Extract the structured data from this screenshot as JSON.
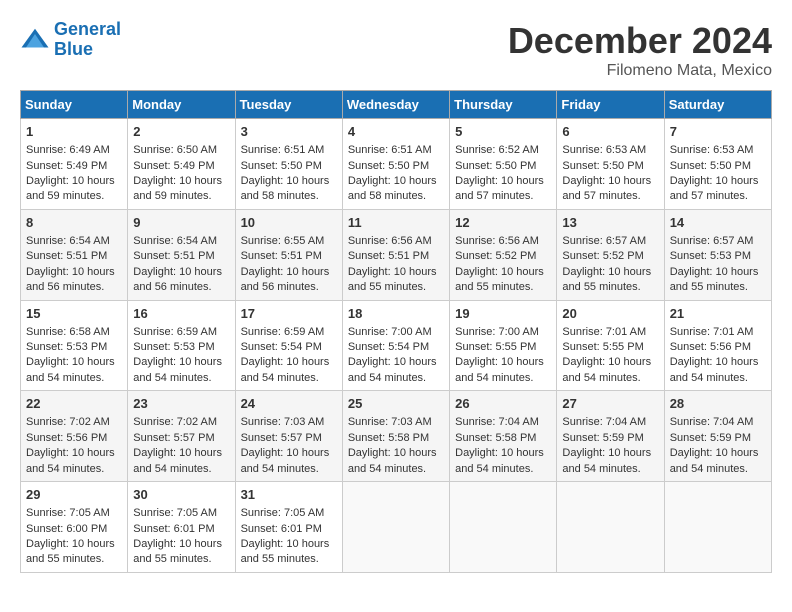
{
  "header": {
    "logo_line1": "General",
    "logo_line2": "Blue",
    "month": "December 2024",
    "location": "Filomeno Mata, Mexico"
  },
  "weekdays": [
    "Sunday",
    "Monday",
    "Tuesday",
    "Wednesday",
    "Thursday",
    "Friday",
    "Saturday"
  ],
  "weeks": [
    [
      {
        "day": "1",
        "sunrise": "6:49 AM",
        "sunset": "5:49 PM",
        "daylight": "10 hours and 59 minutes."
      },
      {
        "day": "2",
        "sunrise": "6:50 AM",
        "sunset": "5:49 PM",
        "daylight": "10 hours and 59 minutes."
      },
      {
        "day": "3",
        "sunrise": "6:51 AM",
        "sunset": "5:50 PM",
        "daylight": "10 hours and 58 minutes."
      },
      {
        "day": "4",
        "sunrise": "6:51 AM",
        "sunset": "5:50 PM",
        "daylight": "10 hours and 58 minutes."
      },
      {
        "day": "5",
        "sunrise": "6:52 AM",
        "sunset": "5:50 PM",
        "daylight": "10 hours and 57 minutes."
      },
      {
        "day": "6",
        "sunrise": "6:53 AM",
        "sunset": "5:50 PM",
        "daylight": "10 hours and 57 minutes."
      },
      {
        "day": "7",
        "sunrise": "6:53 AM",
        "sunset": "5:50 PM",
        "daylight": "10 hours and 57 minutes."
      }
    ],
    [
      {
        "day": "8",
        "sunrise": "6:54 AM",
        "sunset": "5:51 PM",
        "daylight": "10 hours and 56 minutes."
      },
      {
        "day": "9",
        "sunrise": "6:54 AM",
        "sunset": "5:51 PM",
        "daylight": "10 hours and 56 minutes."
      },
      {
        "day": "10",
        "sunrise": "6:55 AM",
        "sunset": "5:51 PM",
        "daylight": "10 hours and 56 minutes."
      },
      {
        "day": "11",
        "sunrise": "6:56 AM",
        "sunset": "5:51 PM",
        "daylight": "10 hours and 55 minutes."
      },
      {
        "day": "12",
        "sunrise": "6:56 AM",
        "sunset": "5:52 PM",
        "daylight": "10 hours and 55 minutes."
      },
      {
        "day": "13",
        "sunrise": "6:57 AM",
        "sunset": "5:52 PM",
        "daylight": "10 hours and 55 minutes."
      },
      {
        "day": "14",
        "sunrise": "6:57 AM",
        "sunset": "5:53 PM",
        "daylight": "10 hours and 55 minutes."
      }
    ],
    [
      {
        "day": "15",
        "sunrise": "6:58 AM",
        "sunset": "5:53 PM",
        "daylight": "10 hours and 54 minutes."
      },
      {
        "day": "16",
        "sunrise": "6:59 AM",
        "sunset": "5:53 PM",
        "daylight": "10 hours and 54 minutes."
      },
      {
        "day": "17",
        "sunrise": "6:59 AM",
        "sunset": "5:54 PM",
        "daylight": "10 hours and 54 minutes."
      },
      {
        "day": "18",
        "sunrise": "7:00 AM",
        "sunset": "5:54 PM",
        "daylight": "10 hours and 54 minutes."
      },
      {
        "day": "19",
        "sunrise": "7:00 AM",
        "sunset": "5:55 PM",
        "daylight": "10 hours and 54 minutes."
      },
      {
        "day": "20",
        "sunrise": "7:01 AM",
        "sunset": "5:55 PM",
        "daylight": "10 hours and 54 minutes."
      },
      {
        "day": "21",
        "sunrise": "7:01 AM",
        "sunset": "5:56 PM",
        "daylight": "10 hours and 54 minutes."
      }
    ],
    [
      {
        "day": "22",
        "sunrise": "7:02 AM",
        "sunset": "5:56 PM",
        "daylight": "10 hours and 54 minutes."
      },
      {
        "day": "23",
        "sunrise": "7:02 AM",
        "sunset": "5:57 PM",
        "daylight": "10 hours and 54 minutes."
      },
      {
        "day": "24",
        "sunrise": "7:03 AM",
        "sunset": "5:57 PM",
        "daylight": "10 hours and 54 minutes."
      },
      {
        "day": "25",
        "sunrise": "7:03 AM",
        "sunset": "5:58 PM",
        "daylight": "10 hours and 54 minutes."
      },
      {
        "day": "26",
        "sunrise": "7:04 AM",
        "sunset": "5:58 PM",
        "daylight": "10 hours and 54 minutes."
      },
      {
        "day": "27",
        "sunrise": "7:04 AM",
        "sunset": "5:59 PM",
        "daylight": "10 hours and 54 minutes."
      },
      {
        "day": "28",
        "sunrise": "7:04 AM",
        "sunset": "5:59 PM",
        "daylight": "10 hours and 54 minutes."
      }
    ],
    [
      {
        "day": "29",
        "sunrise": "7:05 AM",
        "sunset": "6:00 PM",
        "daylight": "10 hours and 55 minutes."
      },
      {
        "day": "30",
        "sunrise": "7:05 AM",
        "sunset": "6:01 PM",
        "daylight": "10 hours and 55 minutes."
      },
      {
        "day": "31",
        "sunrise": "7:05 AM",
        "sunset": "6:01 PM",
        "daylight": "10 hours and 55 minutes."
      },
      null,
      null,
      null,
      null
    ]
  ]
}
